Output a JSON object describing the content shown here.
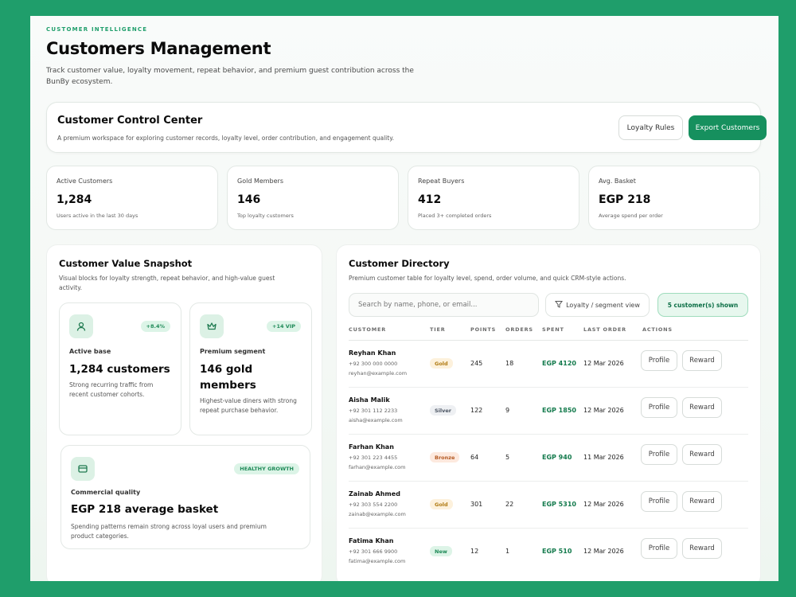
{
  "header": {
    "eyebrow": "CUSTOMER INTELLIGENCE",
    "title": "Customers Management",
    "subtitle": "Track customer value, loyalty movement, repeat behavior, and premium guest contribution across the BunBy ecosystem."
  },
  "control_center": {
    "title": "Customer Control Center",
    "description": "A premium workspace for exploring customer records, loyalty level, order contribution, and engagement quality.",
    "loyalty_rules_label": "Loyalty Rules",
    "export_label": "Export Customers"
  },
  "stats": [
    {
      "label": "Active Customers",
      "value": "1,284",
      "sub": "Users active in the last 30 days"
    },
    {
      "label": "Gold Members",
      "value": "146",
      "sub": "Top loyalty customers"
    },
    {
      "label": "Repeat Buyers",
      "value": "412",
      "sub": "Placed 3+ completed orders"
    },
    {
      "label": "Avg. Basket",
      "value": "EGP 218",
      "sub": "Average spend per order"
    }
  ],
  "snapshot": {
    "title": "Customer Value Snapshot",
    "description": "Visual blocks for loyalty strength, repeat behavior, and high-value guest activity.",
    "cards": [
      {
        "icon": "user-icon",
        "badge": "+8.4%",
        "label": "Active base",
        "value": "1,284 customers",
        "sub": "Strong recurring traffic from recent customer cohorts."
      },
      {
        "icon": "crown-icon",
        "badge": "+14 VIP",
        "label": "Premium segment",
        "value": "146 gold members",
        "sub": "Highest-value diners with strong repeat purchase behavior."
      },
      {
        "icon": "wallet-icon",
        "badge": "HEALTHY GROWTH",
        "label": "Commercial quality",
        "value": "EGP 218 average basket",
        "sub": "Spending patterns remain strong across loyal users and premium product categories."
      }
    ]
  },
  "directory": {
    "title": "Customer Directory",
    "description": "Premium customer table for loyalty level, spend, order volume, and quick CRM-style actions.",
    "search_placeholder": "Search by name, phone, or email...",
    "filter_label": "Loyalty / segment view",
    "shown_label": "5 customer(s) shown",
    "columns": [
      "CUSTOMER",
      "TIER",
      "POINTS",
      "ORDERS",
      "SPENT",
      "LAST ORDER",
      "ACTIONS"
    ],
    "rows": [
      {
        "name": "Reyhan Khan",
        "phone": "+92 300 000 0000",
        "email": "reyhan@example.com",
        "tier": "Gold",
        "points": "245",
        "orders": "18",
        "spent": "EGP 4120",
        "last_order": "12 Mar 2026",
        "profile": "Profile",
        "reward": "Reward"
      },
      {
        "name": "Aisha Malik",
        "phone": "+92 301 112 2233",
        "email": "aisha@example.com",
        "tier": "Silver",
        "points": "122",
        "orders": "9",
        "spent": "EGP 1850",
        "last_order": "12 Mar 2026",
        "profile": "Profile",
        "reward": "Reward"
      },
      {
        "name": "Farhan Khan",
        "phone": "+92 301 223 4455",
        "email": "farhan@example.com",
        "tier": "Bronze",
        "points": "64",
        "orders": "5",
        "spent": "EGP 940",
        "last_order": "11 Mar 2026",
        "profile": "Profile",
        "reward": "Reward"
      },
      {
        "name": "Zainab Ahmed",
        "phone": "+92 303 554 2200",
        "email": "zainab@example.com",
        "tier": "Gold",
        "points": "301",
        "orders": "22",
        "spent": "EGP 5310",
        "last_order": "12 Mar 2026",
        "profile": "Profile",
        "reward": "Reward"
      },
      {
        "name": "Fatima Khan",
        "phone": "+92 301 666 9900",
        "email": "fatima@example.com",
        "tier": "New",
        "points": "12",
        "orders": "1",
        "spent": "EGP 510",
        "last_order": "12 Mar 2026",
        "profile": "Profile",
        "reward": "Reward"
      }
    ]
  },
  "colors": {
    "frame": "#1f9e6b",
    "accent": "#16905e",
    "tier_gold_bg": "#fdf1dc",
    "tier_gold_fg": "#b07a12",
    "tier_silver_bg": "#eef0f3",
    "tier_silver_fg": "#4c5563",
    "tier_bronze_bg": "#fde9de",
    "tier_bronze_fg": "#b45a23",
    "tier_new_bg": "#ddf4e7",
    "tier_new_fg": "#1f8a58"
  }
}
